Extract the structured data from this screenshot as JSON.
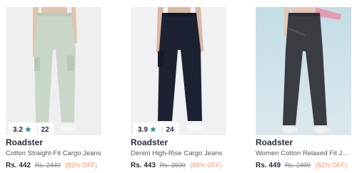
{
  "products": [
    {
      "brand": "Roadster",
      "name": "Cotton Straight-Fit Cargo Jeans",
      "rating": "3.2",
      "rating_count": "22",
      "price": "Rs. 442",
      "mrp": "Rs. 2449",
      "discount": "(82% OFF)",
      "star_icon": "star-icon",
      "jeans_color": "#c9d7c8"
    },
    {
      "brand": "Roadster",
      "name": "Denim High-Rise Cargo Jeans",
      "rating": "3.9",
      "rating_count": "24",
      "price": "Rs. 443",
      "mrp": "Rs. 2699",
      "discount": "(84% OFF)",
      "star_icon": "star-icon",
      "jeans_color": "#1d2233"
    },
    {
      "brand": "Roadster",
      "name": "Women Cotton Relaxed Fit Jeans",
      "price": "Rs. 449",
      "mrp": "Rs. 2499",
      "discount": "(82% OFF)",
      "jeans_color": "#3a3c41"
    }
  ],
  "colors": {
    "rating_star": "#14958f",
    "discount": "#ff905a",
    "text_primary": "#282c3f",
    "text_secondary": "#535766"
  }
}
